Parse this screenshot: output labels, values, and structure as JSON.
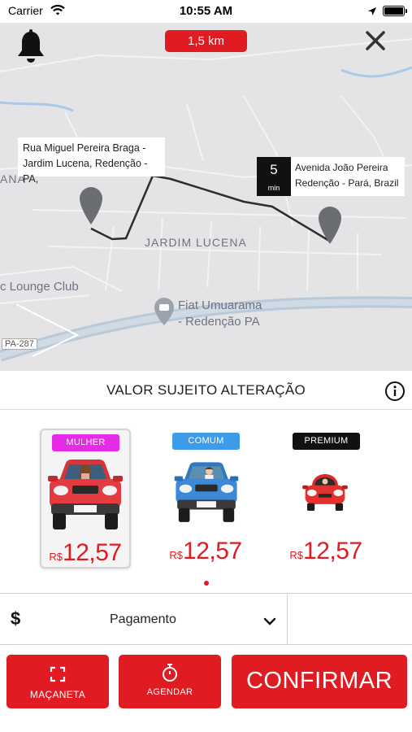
{
  "status_bar": {
    "carrier": "Carrier",
    "time": "10:55 AM"
  },
  "map": {
    "distance": "1,5 km",
    "origin_address": "Rua Miguel Pereira Braga - Jardim Lucena, Redenção - PA,",
    "destination_address": "Avenida João Pereira Redenção - Pará, Brazil",
    "eta_value": "5",
    "eta_unit": "min",
    "labels": {
      "neighborhood": "JARDIM LUCENA",
      "partial_left": "ANA",
      "club": "c Lounge Club",
      "poi_line1": "Fiat Umuarama",
      "poi_line2": "- Redenção PA",
      "road": "PA-287"
    }
  },
  "value_header": {
    "title": "VALOR SUJEITO ALTERAÇÃO"
  },
  "options": [
    {
      "badge": "MULHER",
      "badge_color": "#e62be6",
      "currency": "R$",
      "price": "12,57",
      "selected": true
    },
    {
      "badge": "COMUM",
      "badge_color": "#3e9be8",
      "currency": "R$",
      "price": "12,57",
      "selected": false
    },
    {
      "badge": "PREMIUM",
      "badge_color": "#111111",
      "currency": "R$",
      "price": "12,57",
      "selected": false
    }
  ],
  "payment": {
    "icon_symbol": "$",
    "label": "Pagamento"
  },
  "actions": {
    "macaneta_label": "MAÇANETA",
    "agendar_label": "AGENDAR",
    "confirm_label": "CONFIRMAR"
  },
  "colors": {
    "accent": "#e11b22"
  },
  "icons": [
    "wifi-icon",
    "location-arrow-icon",
    "battery-icon",
    "bell-icon",
    "close-icon",
    "map-pin-icon",
    "info-icon",
    "dollar-icon",
    "chevron-down-icon",
    "expand-icon",
    "stopwatch-icon"
  ]
}
